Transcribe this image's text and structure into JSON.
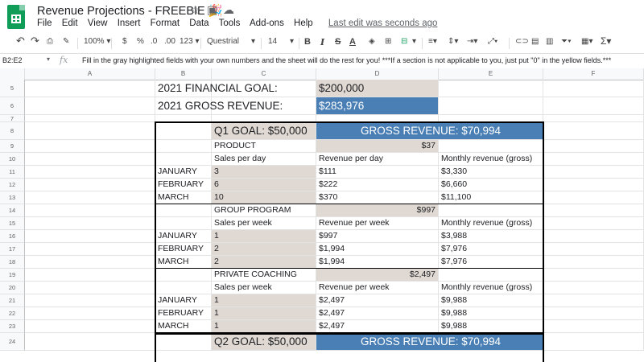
{
  "app": {
    "title": "Revenue Projections - FREEBIE 🎉",
    "menu": [
      "File",
      "Edit",
      "View",
      "Insert",
      "Format",
      "Data",
      "Tools",
      "Add-ons",
      "Help"
    ],
    "last_edit": "Last edit was seconds ago"
  },
  "toolbar": {
    "zoom": "100%",
    "currency": "$",
    "percent": "%",
    "dec_less": ".0",
    "dec_more": ".00",
    "more_formats": "123",
    "font": "Questrial",
    "font_size": "14",
    "bold": "B",
    "italic": "I",
    "strike": "S",
    "text_color": "A",
    "sum": "Σ"
  },
  "formula_bar": {
    "name_box": "B2:E2",
    "fx": "fx",
    "content": "Fill in the gray highlighted fields with your own numbers and the sheet will do the rest for you! ***If a section is not applicable to you, just put \"0\" in the yellow fields.***"
  },
  "columns": [
    "A",
    "B",
    "C",
    "D",
    "E",
    "F"
  ],
  "rows": [
    "5",
    "6",
    "7",
    "8",
    "9",
    "10",
    "11",
    "12",
    "13",
    "14",
    "15",
    "16",
    "17",
    "18",
    "19",
    "20",
    "21",
    "22",
    "23",
    "24"
  ],
  "sheet": {
    "financial_goal_label": "2021 FINANCIAL GOAL:",
    "financial_goal_value": "$200,000",
    "gross_revenue_label": "2021 GROSS REVENUE:",
    "gross_revenue_value": "$283,976",
    "q1": {
      "goal": "Q1 GOAL: $50,000",
      "gross": "GROSS REVENUE: $70,994",
      "product": {
        "name": "PRODUCT",
        "price": "$37",
        "headers": [
          "Sales per day",
          "Revenue per day",
          "Monthly revenue (gross)"
        ],
        "rows": [
          {
            "month": "JANUARY",
            "qty": "3",
            "rev": "$111",
            "monthly": "$3,330"
          },
          {
            "month": "FEBRUARY",
            "qty": "6",
            "rev": "$222",
            "monthly": "$6,660"
          },
          {
            "month": "MARCH",
            "qty": "10",
            "rev": "$370",
            "monthly": "$11,100"
          }
        ]
      },
      "group": {
        "name": "GROUP PROGRAM",
        "price": "$997",
        "headers": [
          "Sales per week",
          "Revenue per week",
          "Monthly revenue (gross)"
        ],
        "rows": [
          {
            "month": "JANUARY",
            "qty": "1",
            "rev": "$997",
            "monthly": "$3,988"
          },
          {
            "month": "FEBRUARY",
            "qty": "2",
            "rev": "$1,994",
            "monthly": "$7,976"
          },
          {
            "month": "MARCH",
            "qty": "2",
            "rev": "$1,994",
            "monthly": "$7,976"
          }
        ]
      },
      "coaching": {
        "name": "PRIVATE COACHING",
        "price": "$2,497",
        "headers": [
          "Sales per week",
          "Revenue per week",
          "Monthly revenue (gross)"
        ],
        "rows": [
          {
            "month": "JANUARY",
            "qty": "1",
            "rev": "$2,497",
            "monthly": "$9,988"
          },
          {
            "month": "FEBRUARY",
            "qty": "1",
            "rev": "$2,497",
            "monthly": "$9,988"
          },
          {
            "month": "MARCH",
            "qty": "1",
            "rev": "$2,497",
            "monthly": "$9,988"
          }
        ]
      }
    },
    "q2": {
      "goal": "Q2 GOAL: $50,000",
      "gross": "GROSS REVENUE: $70,994"
    }
  },
  "colors": {
    "gray_fill": "#e0d9d3",
    "blue_fill": "#4a7fb5",
    "sheets_green": "#0f9d58"
  }
}
